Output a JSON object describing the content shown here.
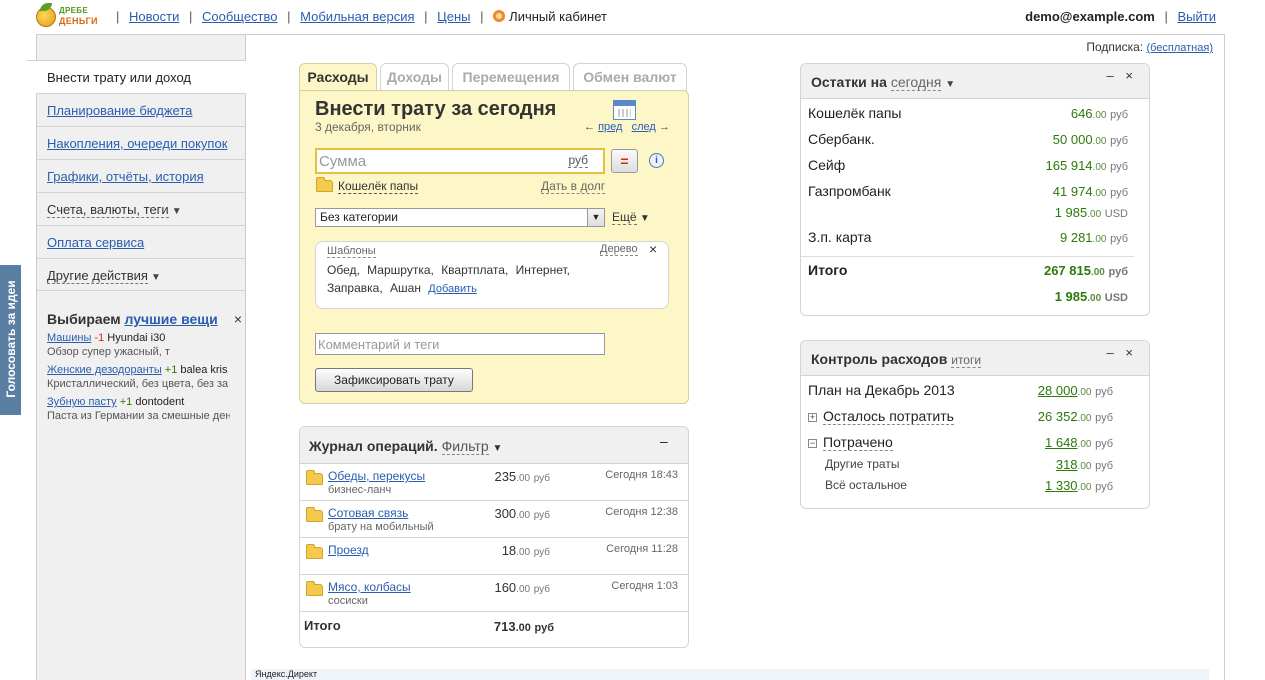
{
  "header": {
    "logo_line1": "ДРЕБЕ",
    "logo_line2": "ДЕНЬГИ",
    "nav": [
      "Новости",
      "Сообщество",
      "Мобильная версия",
      "Цены"
    ],
    "cabinet": "Личный кабинет",
    "user_email": "demo@example.com",
    "logout": "Выйти"
  },
  "subscription": {
    "label": "Подписка:",
    "value": "(бесплатная)"
  },
  "sidebar": {
    "items": [
      {
        "label": "Внести трату или доход",
        "active": true
      },
      {
        "label": "Планирование бюджета"
      },
      {
        "label": "Накопления, очереди покупок"
      },
      {
        "label": "Графики, отчёты, история"
      },
      {
        "label": "Счета, валюты, теги",
        "dropdown": true
      },
      {
        "label": "Оплата сервиса"
      },
      {
        "label": "Другие действия",
        "dropdown": true
      }
    ],
    "promo": {
      "title_prefix": "Выбираем ",
      "title_link": "лучшие вещи",
      "rows": [
        {
          "link": "Машины",
          "score": "-1",
          "item": "Hyundai i30",
          "desc": "Обзор супер ужасный, т"
        },
        {
          "link": "Женские дезодоранты",
          "score": "+1",
          "item": "balea kris",
          "desc": "Кристаллический, без цвета, без за"
        },
        {
          "link": "Зубную пасту",
          "score": "+1",
          "item": "dontodent",
          "desc": "Паста из Германии за смешные день"
        }
      ]
    },
    "vote_tab": "Голосовать за идеи"
  },
  "entry": {
    "tabs": [
      "Расходы",
      "Доходы",
      "Перемещения",
      "Обмен валют"
    ],
    "title": "Внести трату за сегодня",
    "date": "3 декабря, вторник",
    "prev": "пред",
    "next": "след",
    "amount_placeholder": "Сумма",
    "currency": "руб",
    "eq_button": "=",
    "info": "i",
    "wallet": "Кошелёк папы",
    "debt_link": "Дать в долг",
    "category": "Без категории",
    "more": "Ещё",
    "templates": {
      "title": "Шаблоны",
      "tree": "Дерево",
      "items_row1": [
        "Обед,",
        "Маршрутка,",
        "Квартплата,",
        "Интернет,"
      ],
      "items_row2": [
        "Заправка,",
        "Ашан"
      ],
      "add": "Добавить"
    },
    "comment_placeholder": "Комментарий и теги",
    "submit": "Зафиксировать трату"
  },
  "journal": {
    "title": "Журнал операций.",
    "filter": "Фильтр",
    "rows": [
      {
        "name": "Обеды, перекусы",
        "sub": "бизнес-ланч",
        "amount": "235",
        "cents": ".00",
        "unit": "руб",
        "time": "Сегодня 18:43"
      },
      {
        "name": "Сотовая связь",
        "sub": "брату на мобильный",
        "amount": "300",
        "cents": ".00",
        "unit": "руб",
        "time": "Сегодня 12:38"
      },
      {
        "name": "Проезд",
        "sub": "",
        "amount": "18",
        "cents": ".00",
        "unit": "руб",
        "time": "Сегодня 11:28"
      },
      {
        "name": "Мясо, колбасы",
        "sub": "сосиски",
        "amount": "160",
        "cents": ".00",
        "unit": "руб",
        "time": "Сегодня 1:03"
      }
    ],
    "total_label": "Итого",
    "total_amount": "713",
    "total_cents": ".00",
    "total_unit": "руб"
  },
  "balances": {
    "title": "Остатки на",
    "period": "сегодня",
    "rows": [
      {
        "name": "Кошелёк папы",
        "value": "646",
        "cents": ".00",
        "unit": "руб"
      },
      {
        "name": "Сбербанк.",
        "value": "50 000",
        "cents": ".00",
        "unit": "руб"
      },
      {
        "name": "Сейф",
        "value": "165 914",
        "cents": ".00",
        "unit": "руб"
      },
      {
        "name": "Газпромбанк",
        "value": "41 974",
        "cents": ".00",
        "unit": "руб"
      },
      {
        "name": "",
        "value": "1 985",
        "cents": ".00",
        "unit": "USD"
      },
      {
        "name": "З.п. карта",
        "value": "9 281",
        "cents": ".00",
        "unit": "руб"
      }
    ],
    "total_label": "Итого",
    "total_rub": "267 815",
    "total_rub_cents": ".00",
    "total_rub_unit": "руб",
    "total_usd": "1 985",
    "total_usd_cents": ".00",
    "total_usd_unit": "USD"
  },
  "control": {
    "title": "Контроль расходов",
    "sub": "итоги",
    "rows": [
      {
        "label": "План на Декабрь 2013",
        "value": "28 000",
        "cents": ".00",
        "unit": "руб"
      },
      {
        "label": "Осталось потратить",
        "value": "26 352",
        "cents": ".00",
        "unit": "руб",
        "toggle": "+"
      },
      {
        "label": "Потрачено",
        "value": "1 648",
        "cents": ".00",
        "unit": "руб",
        "toggle": "−"
      },
      {
        "label": "Другие траты",
        "value": "318",
        "cents": ".00",
        "unit": "руб"
      },
      {
        "label": "Всё остальное",
        "value": "1 330",
        "cents": ".00",
        "unit": "руб"
      }
    ]
  },
  "ads": {
    "label": "Яндекс.Директ"
  },
  "widget_controls": {
    "minimize": "–",
    "close": "×"
  },
  "colors": {
    "accent_link": "#2a5db0",
    "money_green": "#2b7a0b",
    "entry_bg": "#fdf7c7",
    "vote_tab_bg": "#5b7fa3"
  }
}
